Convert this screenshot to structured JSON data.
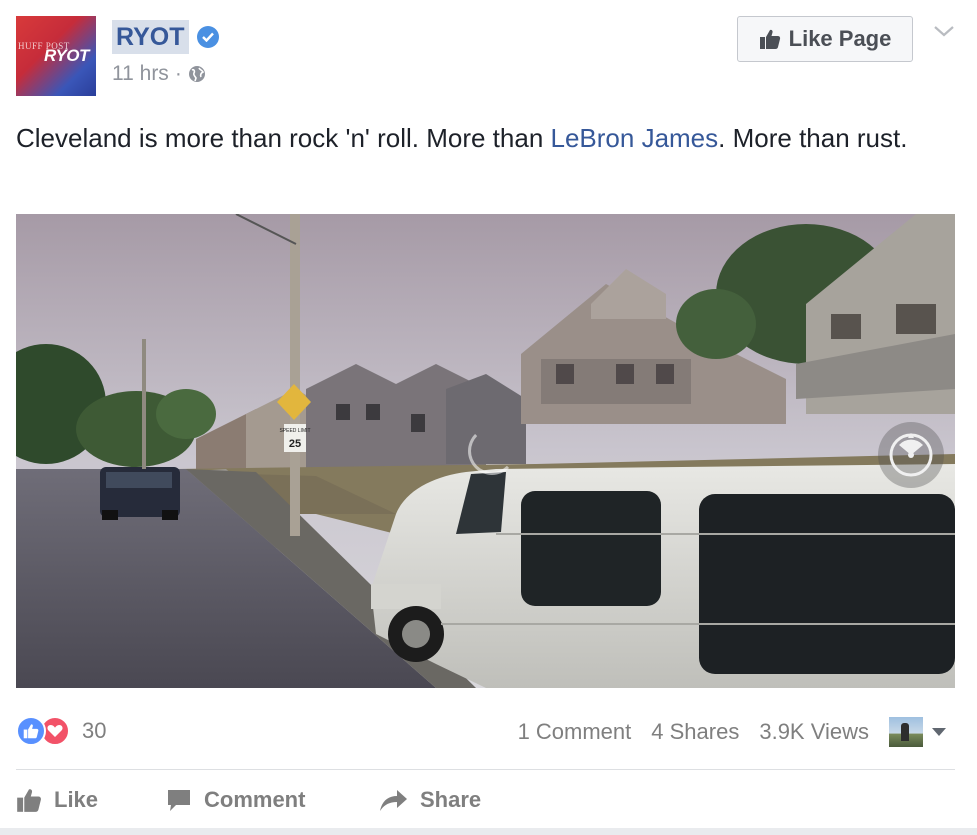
{
  "header": {
    "avatar_text_top": "HUFF POST",
    "avatar_text_main": "RYOT",
    "page_name": "RYOT",
    "time": "11 hrs",
    "separator": "·",
    "like_page_label": "Like Page"
  },
  "post": {
    "text_before": "Cleveland is more than rock 'n' roll. More than ",
    "text_link": "LeBron James",
    "text_after": ". More than rust."
  },
  "video": {
    "sign_speed": "25",
    "sign_label": "SPEED LIMIT"
  },
  "stats": {
    "reaction_count": "30",
    "comments": "1 Comment",
    "shares": "4 Shares",
    "views": "3.9K Views"
  },
  "actions": {
    "like": "Like",
    "comment": "Comment",
    "share": "Share"
  },
  "colors": {
    "link": "#365899",
    "like_reaction": "#5890ff",
    "love_reaction": "#f25268",
    "verified": "#4a90e2"
  }
}
